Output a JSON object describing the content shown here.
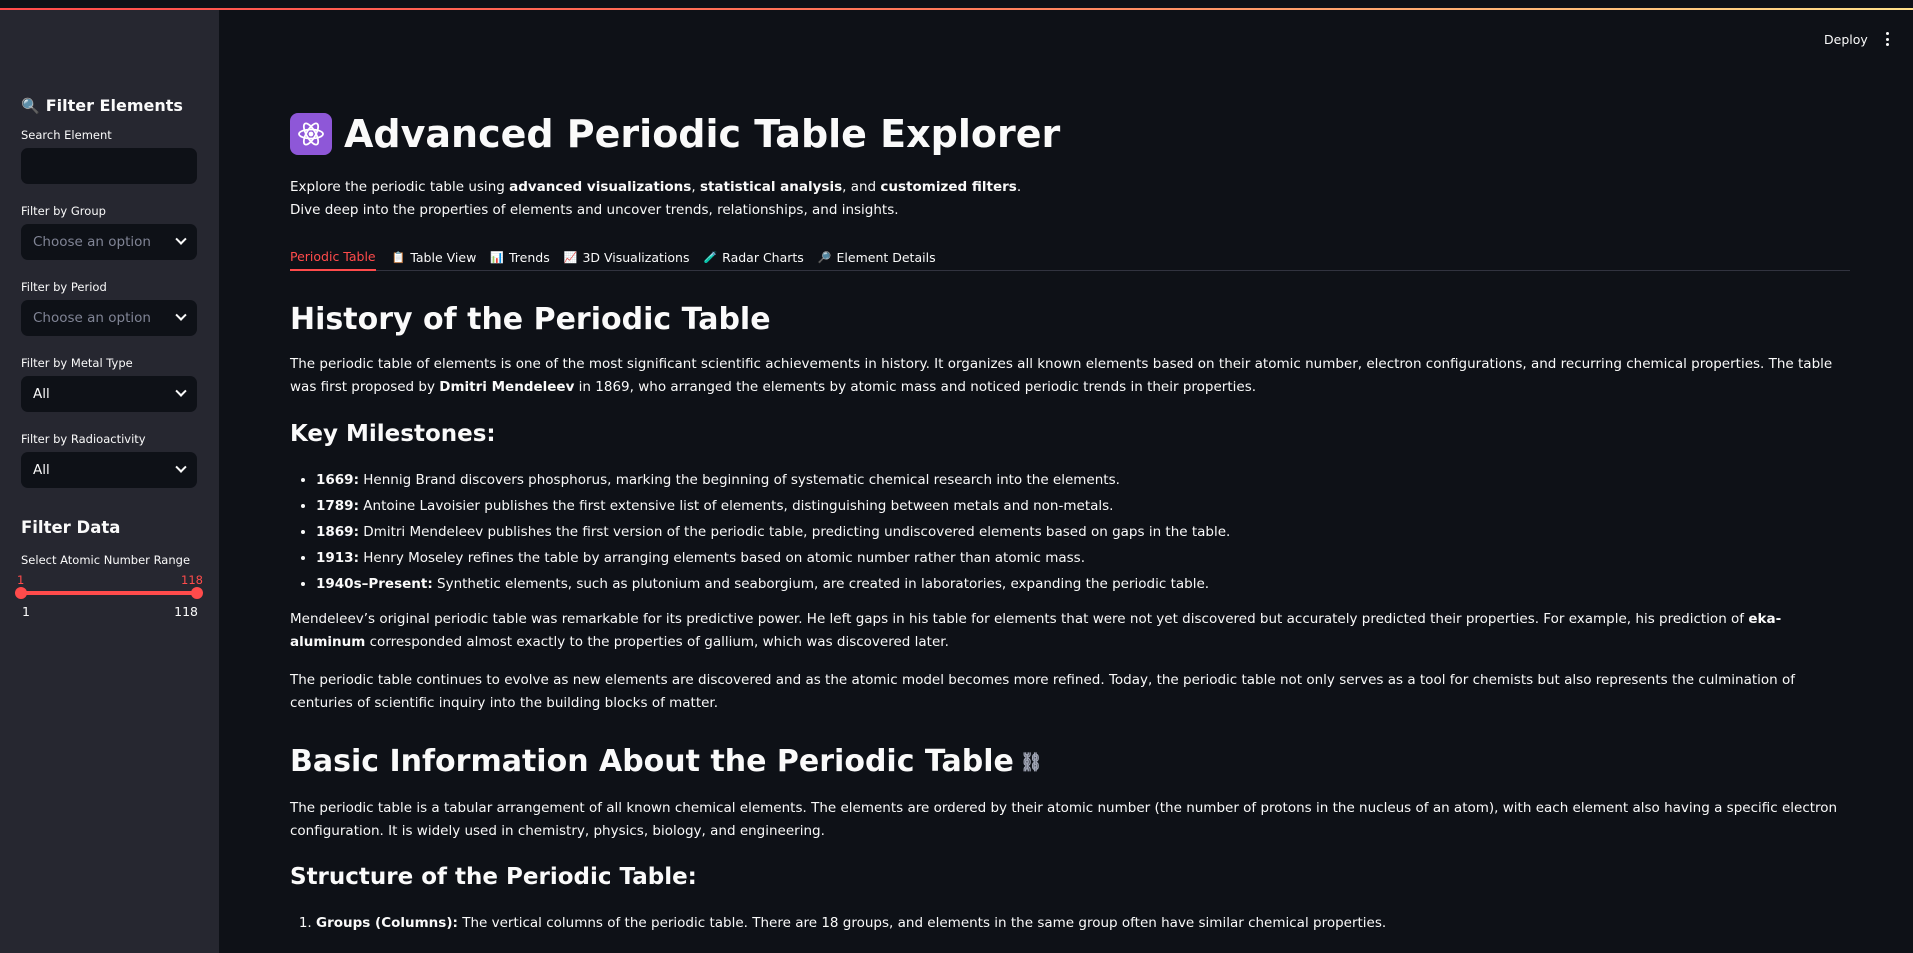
{
  "header": {
    "deploy_label": "Deploy"
  },
  "sidebar": {
    "title": "Filter Elements",
    "search_label": "Search Element",
    "search_value": "",
    "group_label": "Filter by Group",
    "group_placeholder": "Choose an option",
    "period_label": "Filter by Period",
    "period_placeholder": "Choose an option",
    "metal_label": "Filter by Metal Type",
    "metal_value": "All",
    "radio_label": "Filter by Radioactivity",
    "radio_value": "All",
    "filter_data_title": "Filter Data",
    "range_label": "Select Atomic Number Range",
    "range_low": "1",
    "range_high": "118",
    "range_min": "1",
    "range_max": "118",
    "range_selection": [
      1,
      118
    ]
  },
  "main": {
    "title": "Advanced Periodic Table Explorer",
    "intro": {
      "l1_a": "Explore the periodic table using ",
      "l1_b": "advanced visualizations",
      "l1_c": ", ",
      "l1_d": "statistical analysis",
      "l1_e": ", and ",
      "l1_f": "customized filters",
      "l1_g": ".",
      "l2": "Dive deep into the properties of elements and uncover trends, relationships, and insights."
    },
    "tabs": [
      {
        "label": "Periodic Table",
        "icon": ""
      },
      {
        "label": "Table View",
        "icon": "📋"
      },
      {
        "label": "Trends",
        "icon": "📊"
      },
      {
        "label": "3D Visualizations",
        "icon": "📈"
      },
      {
        "label": "Radar Charts",
        "icon": "🧪"
      },
      {
        "label": "Element Details",
        "icon": "🔎"
      }
    ],
    "history_title": "History of the Periodic Table",
    "history_p1_a": "The periodic table of elements is one of the most significant scientific achievements in history. It organizes all known elements based on their atomic number, electron configurations, and recurring chemical properties. The table was first proposed by ",
    "history_p1_b": "Dmitri Mendeleev",
    "history_p1_c": " in 1869, who arranged the elements by atomic mass and noticed periodic trends in their properties.",
    "milestones_title": "Key Milestones:",
    "milestones": [
      {
        "year": "1669:",
        "text": " Hennig Brand discovers phosphorus, marking the beginning of systematic chemical research into the elements."
      },
      {
        "year": "1789:",
        "text": " Antoine Lavoisier publishes the first extensive list of elements, distinguishing between metals and non-metals."
      },
      {
        "year": "1869:",
        "text": " Dmitri Mendeleev publishes the first version of the periodic table, predicting undiscovered elements based on gaps in the table."
      },
      {
        "year": "1913:",
        "text": " Henry Moseley refines the table by arranging elements based on atomic number rather than atomic mass."
      },
      {
        "year": "1940s–Present:",
        "text": " Synthetic elements, such as plutonium and seaborgium, are created in laboratories, expanding the periodic table."
      }
    ],
    "mendeleev_p_a": "Mendeleev’s original periodic table was remarkable for its predictive power. He left gaps in his table for elements that were not yet discovered but accurately predicted their properties. For example, his prediction of ",
    "mendeleev_p_b": "eka-aluminum",
    "mendeleev_p_c": " corresponded almost exactly to the properties of gallium, which was discovered later.",
    "evolve_p": "The periodic table continues to evolve as new elements are discovered and as the atomic model becomes more refined. Today, the periodic table not only serves as a tool for chemists but also represents the culmination of centuries of scientific inquiry into the building blocks of matter.",
    "basic_title": "Basic Information About the Periodic Table",
    "basic_p": "The periodic table is a tabular arrangement of all known chemical elements. The elements are ordered by their atomic number (the number of protons in the nucleus of an atom), with each element also having a specific electron configuration. It is widely used in chemistry, physics, biology, and engineering.",
    "structure_title": "Structure of the Periodic Table:",
    "structure_items": [
      {
        "head": "Groups (Columns):",
        "text": " The vertical columns of the periodic table. There are 18 groups, and elements in the same group often have similar chemical properties."
      }
    ]
  },
  "colors": {
    "accent": "#ff4b4b",
    "background": "#0e1117",
    "sidebar": "#262730"
  },
  "icons": {
    "sidebar_title": "search-icon",
    "atom": "atom-icon",
    "link": "link-icon",
    "menu": "kebab-menu-icon"
  }
}
